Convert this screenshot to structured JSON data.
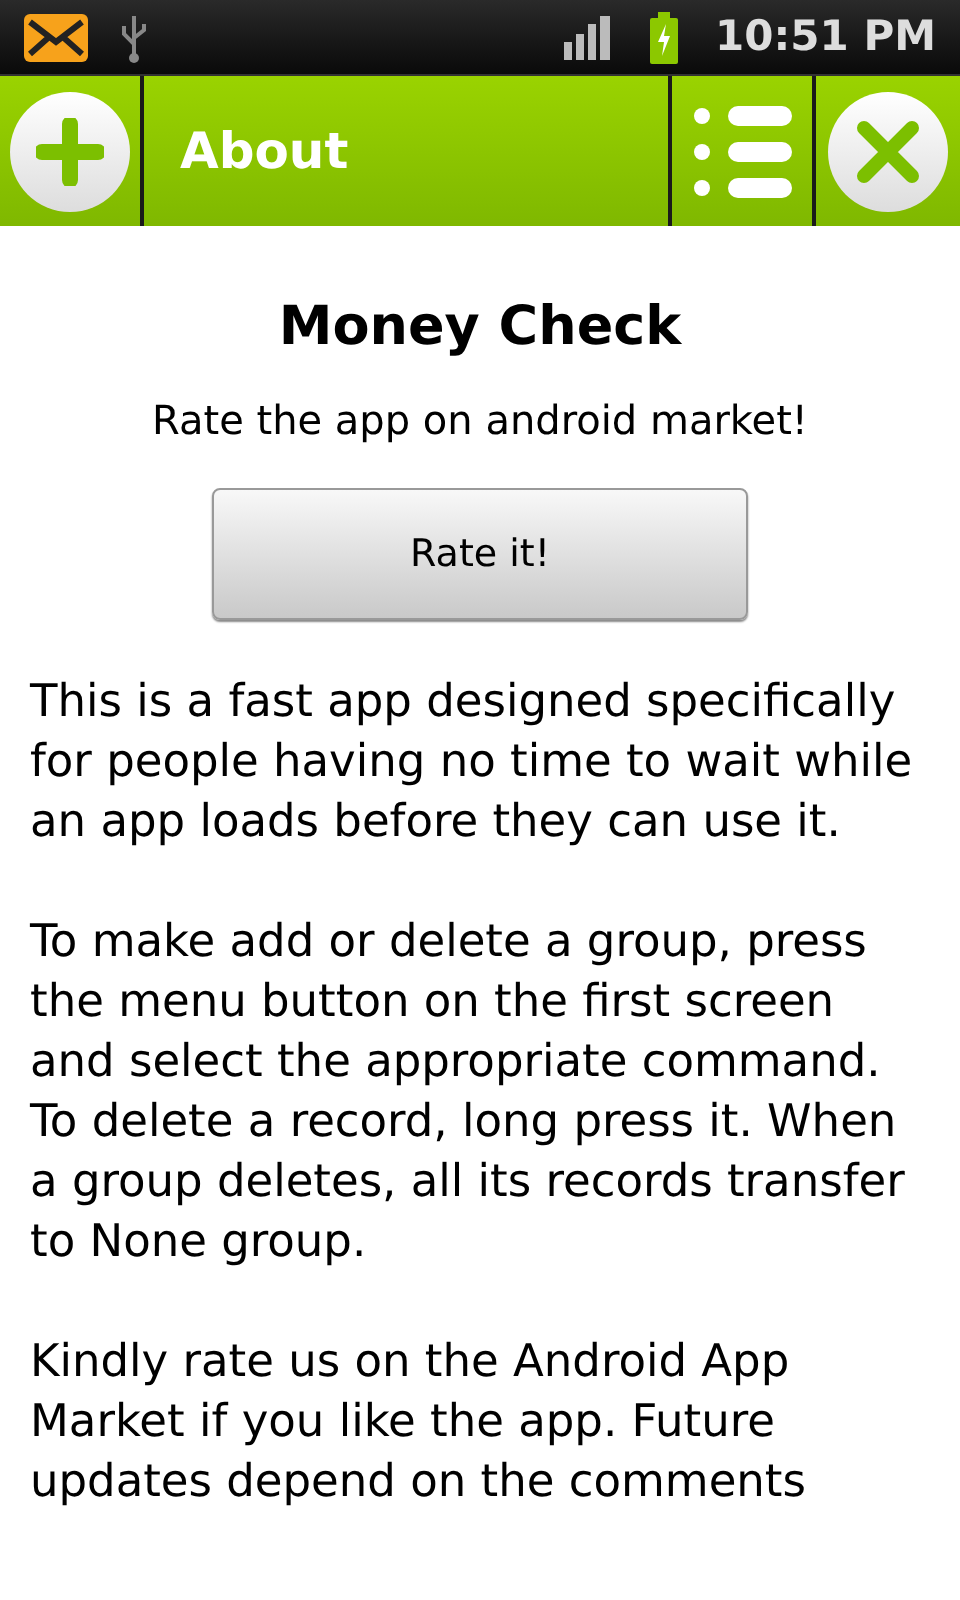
{
  "status_bar": {
    "time": "10:51 PM"
  },
  "toolbar": {
    "title": "About"
  },
  "app_name": "Money Check",
  "subtitle": "Rate the app on android market!",
  "rate_button": "Rate it!",
  "paragraphs": [
    "This is a fast app designed specifically for people having no time to wait while an app loads before they can use it.",
    "To make add or delete a group, press the menu button on the first screen and select the appropriate command. To delete a record, long press it. When a group deletes, all its records transfer to None group.",
    "Kindly rate us on the Android App Market if you like the app. Future updates depend on the comments"
  ]
}
